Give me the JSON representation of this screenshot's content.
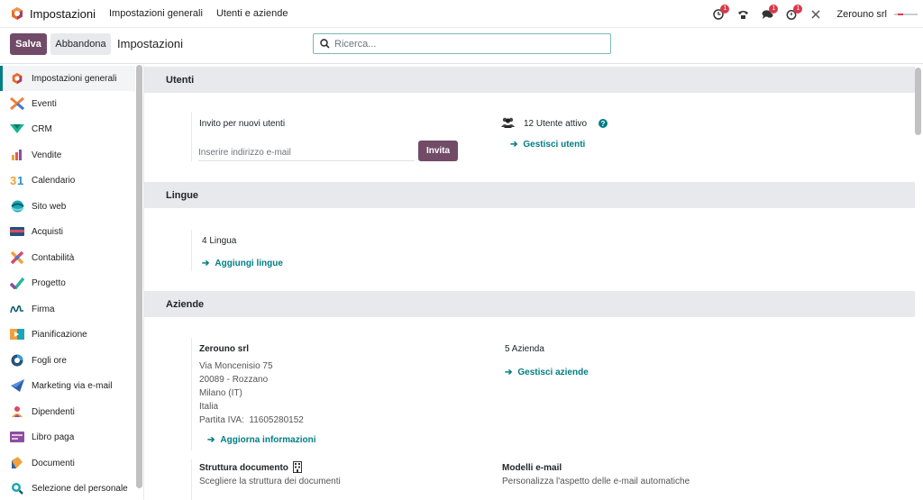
{
  "topbar": {
    "app_name": "Impostazioni",
    "menu": [
      "Impostazioni generali",
      "Utenti e aziende"
    ],
    "systray": [
      {
        "icon": "activity-clock-icon",
        "badge": "1"
      },
      {
        "icon": "phone-icon",
        "badge": ""
      },
      {
        "icon": "chat-icon",
        "badge": "1"
      },
      {
        "icon": "timer-icon",
        "badge": "1"
      },
      {
        "icon": "tools-icon",
        "badge": ""
      }
    ],
    "company": "Zerouno srl"
  },
  "controlbar": {
    "save_label": "Salva",
    "discard_label": "Abbandona",
    "title": "Impostazioni",
    "search_placeholder": "Ricerca..."
  },
  "sidebar": {
    "items": [
      {
        "label": "Impostazioni generali",
        "icon": "settings-app-icon",
        "active": true
      },
      {
        "label": "Eventi",
        "icon": "events-app-icon"
      },
      {
        "label": "CRM",
        "icon": "crm-app-icon"
      },
      {
        "label": "Vendite",
        "icon": "sales-app-icon"
      },
      {
        "label": "Calendario",
        "icon": "calendar-app-icon"
      },
      {
        "label": "Sito web",
        "icon": "website-app-icon"
      },
      {
        "label": "Acquisti",
        "icon": "purchase-app-icon"
      },
      {
        "label": "Contabilità",
        "icon": "accounting-app-icon"
      },
      {
        "label": "Progetto",
        "icon": "project-app-icon"
      },
      {
        "label": "Firma",
        "icon": "sign-app-icon"
      },
      {
        "label": "Pianificazione",
        "icon": "planning-app-icon"
      },
      {
        "label": "Fogli ore",
        "icon": "timesheet-app-icon"
      },
      {
        "label": "Marketing via e-mail",
        "icon": "email-marketing-app-icon"
      },
      {
        "label": "Dipendenti",
        "icon": "employees-app-icon"
      },
      {
        "label": "Libro paga",
        "icon": "payroll-app-icon"
      },
      {
        "label": "Documenti",
        "icon": "documents-app-icon"
      },
      {
        "label": "Selezione del personale",
        "icon": "recruitment-app-icon"
      }
    ]
  },
  "sections": {
    "users": {
      "title": "Utenti",
      "invite_label": "Invito per nuovi utenti",
      "invite_placeholder": "Inserire indirizzo e-mail",
      "invite_button": "Invita",
      "active_users": "12 Utente attivo",
      "manage_users": "Gestisci utenti"
    },
    "languages": {
      "title": "Lingue",
      "count": "4 Lingua",
      "add_languages": "Aggiungi lingue"
    },
    "companies": {
      "title": "Aziende",
      "company_name": "Zerouno srl",
      "address_lines": [
        "Via Moncenisio 75",
        "20089 - Rozzano",
        "Milano (IT)",
        "Italia",
        "Partita IVA:  11605280152"
      ],
      "update_info": "Aggiorna informazioni",
      "count": "5 Azienda",
      "manage_companies": "Gestisci aziende",
      "doc_layout_title": "Struttura documento",
      "doc_layout_desc": "Scegliere la struttura dei documenti",
      "email_templates_title": "Modelli e-mail",
      "email_templates_desc": "Personalizza l'aspetto delle e-mail automatiche"
    }
  },
  "colors": {
    "primary": "#714b67",
    "link": "#017e84",
    "section_bg": "#e7e9ed"
  }
}
